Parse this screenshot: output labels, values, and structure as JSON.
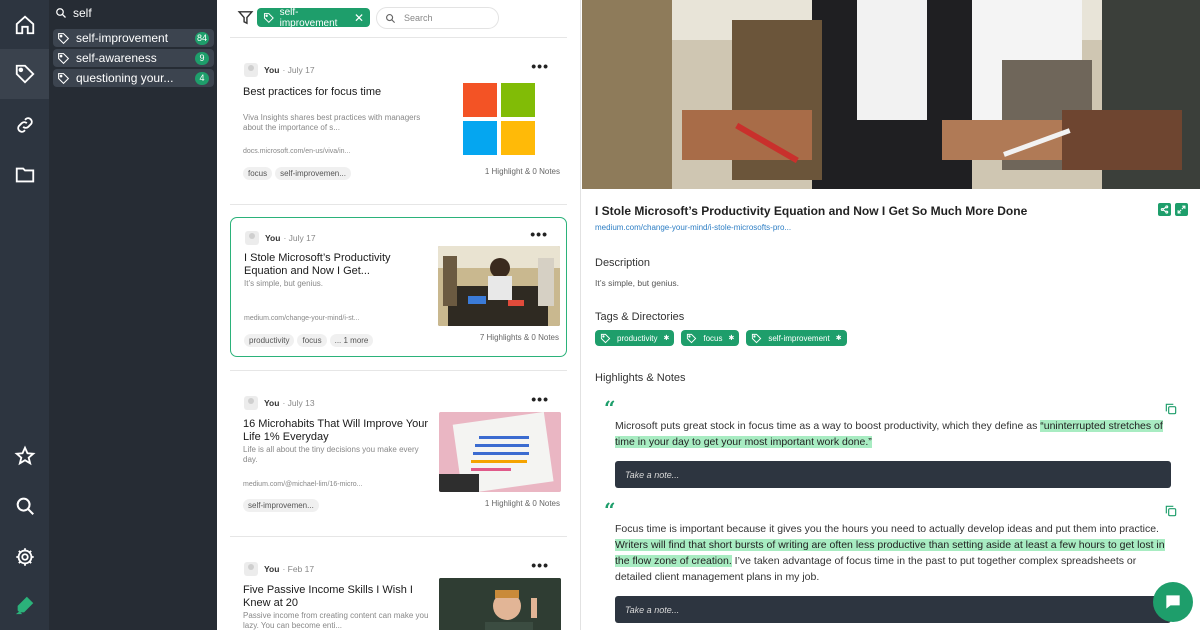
{
  "tag_panel": {
    "search_value": "self",
    "tags": [
      {
        "label": "self-improvement",
        "count": "84"
      },
      {
        "label": "self-awareness",
        "count": "9"
      },
      {
        "label": "questioning your...",
        "count": "4"
      }
    ]
  },
  "list": {
    "active_filter": "self-improvement",
    "search_placeholder": "Search",
    "cards": [
      {
        "author": "You",
        "date": "· July 17",
        "title": "Best practices for focus time",
        "desc": "Viva Insights shares best practices with managers about the importance of s...",
        "url": "docs.microsoft.com/en-us/viva/in...",
        "chips": [
          "focus",
          "self-improvemen..."
        ],
        "stats": "1 Highlight & 0 Notes"
      },
      {
        "author": "You",
        "date": "· July 17",
        "title": "I Stole Microsoft’s Productivity Equation and Now I Get...",
        "desc": "It’s simple, but genius.",
        "url": "medium.com/change-your-mind/i-st...",
        "chips": [
          "productivity",
          "focus",
          "... 1 more"
        ],
        "stats": "7 Highlights & 0 Notes"
      },
      {
        "author": "You",
        "date": "· July 13",
        "title": "16 Microhabits That Will Improve Your Life 1% Everyday",
        "desc": "Life is all about the tiny decisions you make every day.",
        "url": "medium.com/@michael-lim/16-micro...",
        "chips": [
          "self-improvemen..."
        ],
        "stats": "1 Highlight & 0 Notes"
      },
      {
        "author": "You",
        "date": "· Feb 17",
        "title": "Five Passive Income Skills I Wish I Knew at 20",
        "desc": "Passive income from creating content can make you lazy. You can become enti...",
        "url": "",
        "chips": [],
        "stats": ""
      }
    ]
  },
  "detail": {
    "title": "I Stole Microsoft’s Productivity Equation and Now I Get So Much More Done",
    "url": "medium.com/change-your-mind/i-stole-microsofts-pro...",
    "description_heading": "Description",
    "description": "It’s simple, but genius.",
    "tags_heading": "Tags & Directories",
    "tags": [
      "productivity",
      "focus",
      "self-improvement"
    ],
    "highlights_heading": "Highlights & Notes",
    "highlights": [
      {
        "plain": "Microsoft puts great stock in focus time as a way to boost productivity, which they define as ",
        "marked": "“uninterrupted stretches of time in your day to get your most important work done.”",
        "after": ""
      },
      {
        "plain": "Focus time is important because it gives you the hours you need to actually develop ideas and put them into practice. ",
        "marked": "Writers will find that short bursts of writing are often less productive than setting aside at least a few hours to get lost in the flow zone of creation.",
        "after": " I’ve taken advantage of focus time in the past to put together complex spreadsheets or detailed client management plans in my job."
      }
    ],
    "note_placeholder": "Take a note..."
  },
  "colors": {
    "accent": "#1e9e6b",
    "rail": "#2d3540",
    "panel": "#262c34",
    "highlight": "#a8ecc2"
  }
}
